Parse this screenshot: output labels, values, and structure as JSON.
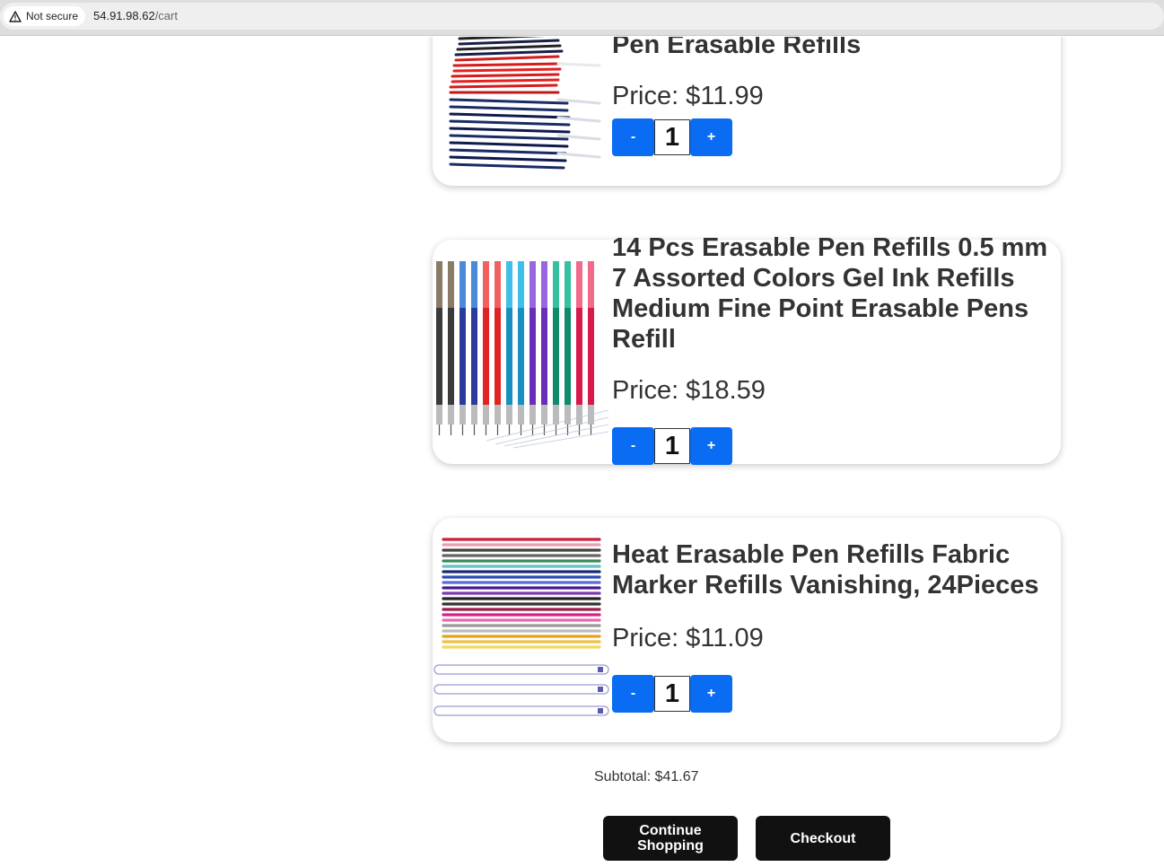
{
  "browser": {
    "security_label": "Not secure",
    "url_host": "54.91.98.62",
    "url_path": "/cart"
  },
  "cart": {
    "items": [
      {
        "title": "Pen Erasable Refills",
        "price": "Price: $11.99",
        "quantity": "1",
        "decrement_label": "-",
        "increment_label": "+"
      },
      {
        "title": "14 Pcs Erasable Pen Refills 0.5 mm 7 Assorted Colors Gel Ink Refills Medium Fine Point Erasable Pens Refill",
        "price": "Price: $18.59",
        "quantity": "1",
        "decrement_label": "-",
        "increment_label": "+"
      },
      {
        "title": "Heat Erasable Pen Refills Fabric Marker Refills Vanishing, 24Pieces",
        "price": "Price: $11.09",
        "quantity": "1",
        "decrement_label": "-",
        "increment_label": "+"
      }
    ],
    "subtotal": "Subtotal: $41.67",
    "continue_label": "Continue Shopping",
    "checkout_label": "Checkout"
  },
  "colors": {
    "accent": "#0a6cf2",
    "dark_button": "#111111",
    "text": "#333333"
  }
}
